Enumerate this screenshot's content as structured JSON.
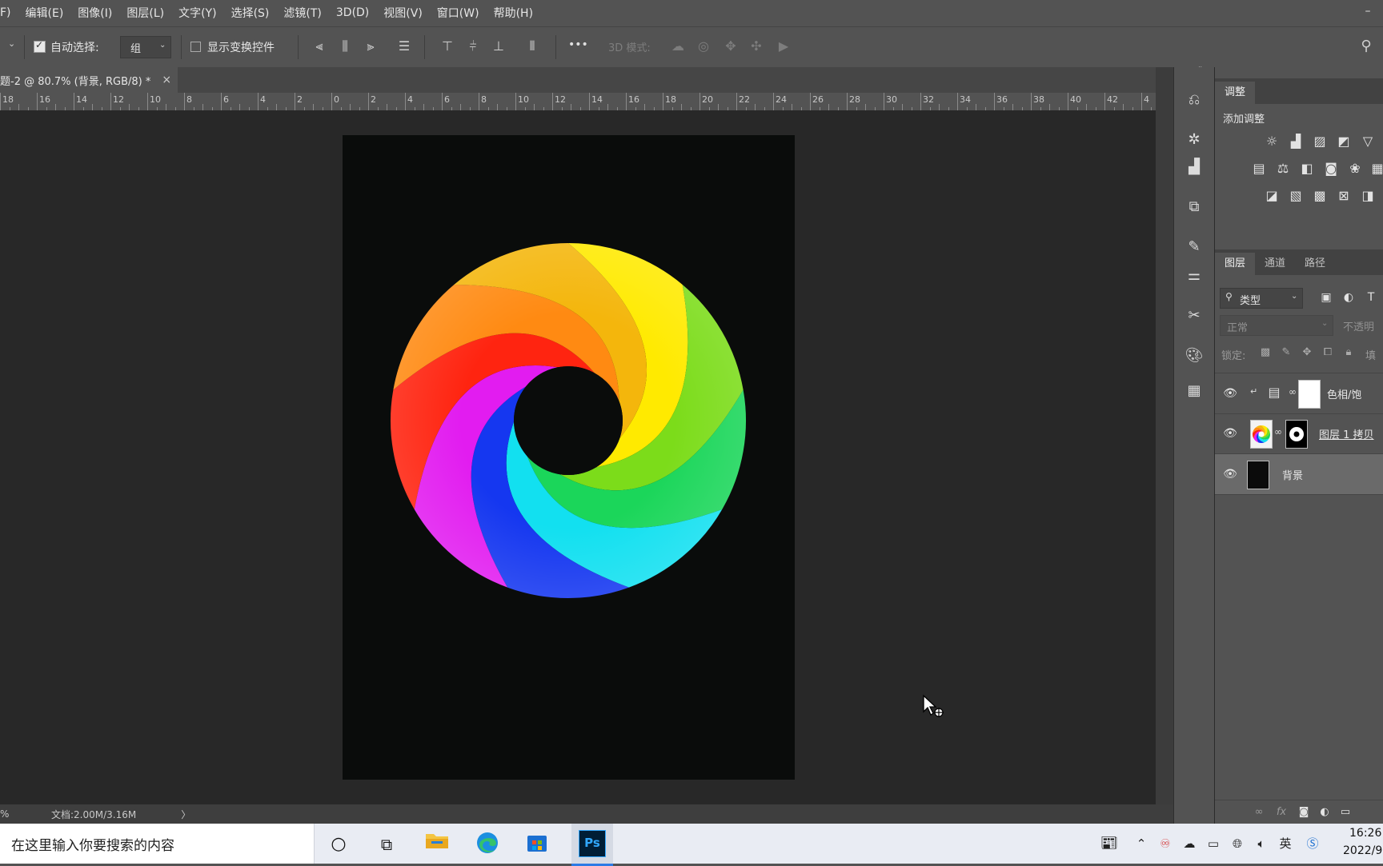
{
  "menu": [
    "F)",
    "编辑(E)",
    "图像(I)",
    "图层(L)",
    "文字(Y)",
    "选择(S)",
    "滤镜(T)",
    "3D(D)",
    "视图(V)",
    "窗口(W)",
    "帮助(H)"
  ],
  "window_min": "–",
  "options": {
    "auto_select_label": "自动选择:",
    "auto_select_value": "组",
    "show_transform_label": "显示变换控件",
    "more": "•••",
    "mode3d_label": "3D 模式:"
  },
  "doc_tab": {
    "title": "题-2 @ 80.7% (背景, RGB/8) *",
    "close": "×"
  },
  "ruler_labels": [
    "18",
    "16",
    "14",
    "12",
    "10",
    "8",
    "6",
    "4",
    "2",
    "0",
    "2",
    "4",
    "6",
    "8",
    "10",
    "12",
    "14",
    "16",
    "18",
    "20",
    "22",
    "24",
    "26",
    "28",
    "30",
    "32",
    "34",
    "36",
    "38",
    "40",
    "42",
    "4"
  ],
  "status": {
    "zoom_fragment": "%",
    "doc_size": "文档:2.00M/3.16M",
    "arrow": "〉"
  },
  "adjust_panel": {
    "tab": "调整",
    "add_label": "添加调整"
  },
  "layers_panel": {
    "tabs": [
      "图层",
      "通道",
      "路径"
    ],
    "filter_kind": "类型",
    "blend_mode": "正常",
    "opacity_label": "不透明",
    "lock_label": "锁定:",
    "fill_label": "填",
    "layers": [
      {
        "name": "色相/饱",
        "type": "adjustment",
        "visible": true
      },
      {
        "name": "图层 1 拷贝",
        "type": "smart",
        "visible": true
      },
      {
        "name": "背景",
        "type": "background",
        "visible": true
      }
    ]
  },
  "taskbar": {
    "search_placeholder": "在这里输入你要搜索的内容",
    "time": "16:26",
    "date": "2022/9"
  },
  "colors": {
    "swirl": [
      "#ffea00",
      "#7cdc1a",
      "#1bd65a",
      "#12e0f0",
      "#1537f0",
      "#e21cf0",
      "#ff2410",
      "#ff8a12",
      "#f4b60c"
    ]
  }
}
